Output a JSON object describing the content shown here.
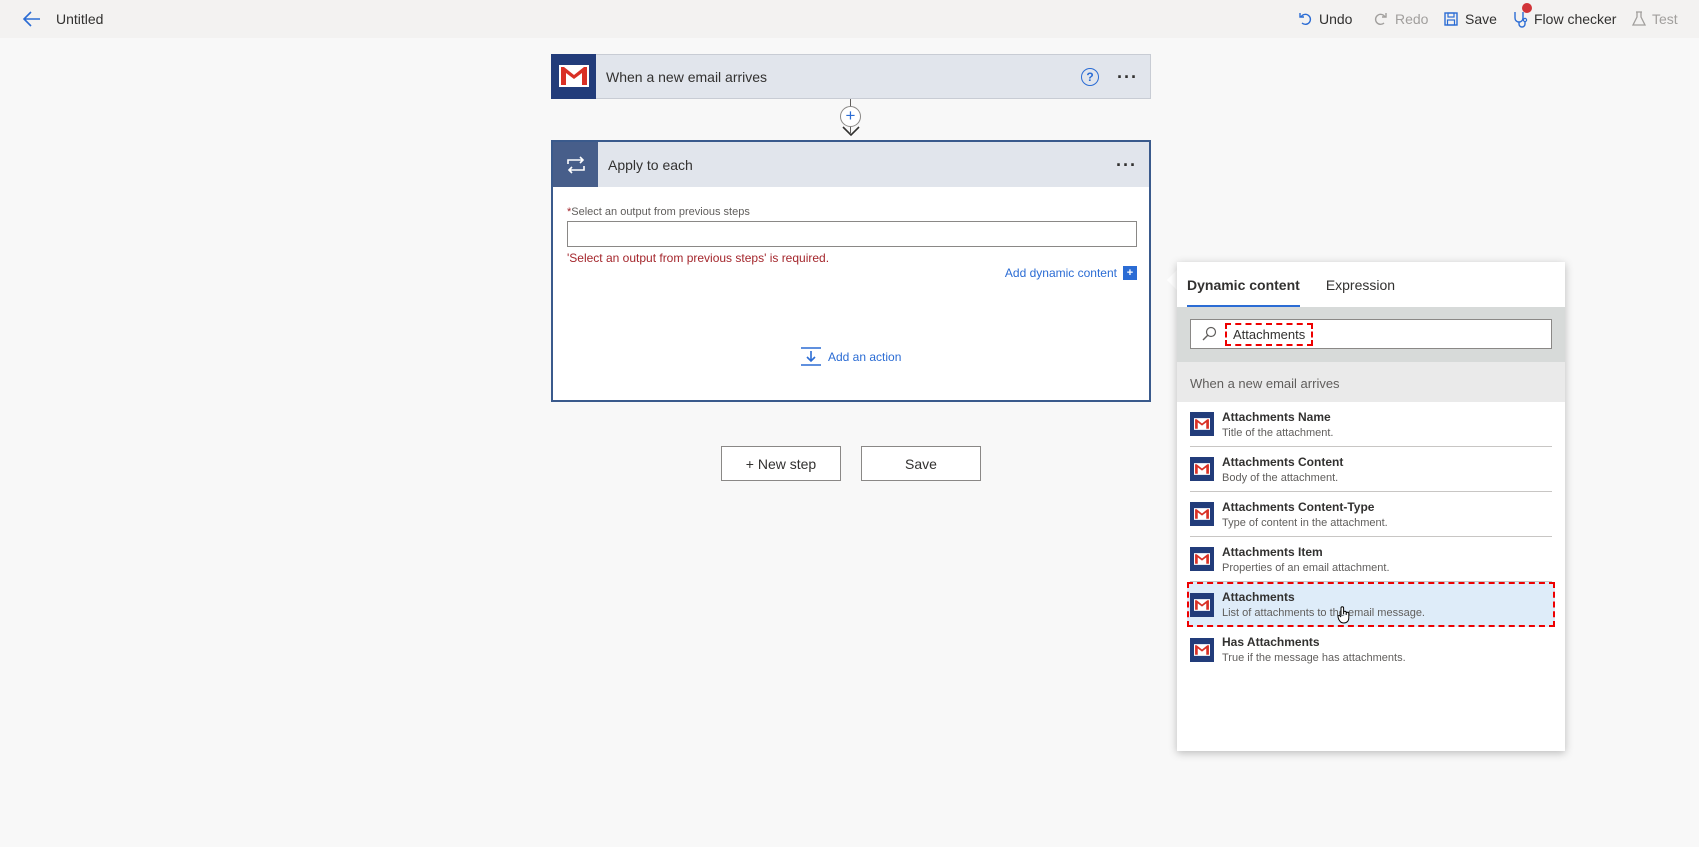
{
  "topbar": {
    "title": "Untitled",
    "undo": "Undo",
    "redo": "Redo",
    "save": "Save",
    "flow_checker": "Flow checker",
    "test": "Test"
  },
  "trigger": {
    "title": "When a new email arrives"
  },
  "apply": {
    "title": "Apply to each",
    "field_label": "Select an output from previous steps",
    "required_mark": "*",
    "error": "'Select an output from previous steps' is required.",
    "dynamic_link": "Add dynamic content",
    "add_action": "Add an action"
  },
  "buttons": {
    "new_step": "+ New step",
    "save": "Save"
  },
  "panel": {
    "tabs": [
      "Dynamic content",
      "Expression"
    ],
    "search_value": "Attachments",
    "group": "When a new email arrives",
    "items": [
      {
        "name": "Attachments Name",
        "desc": "Title of the attachment."
      },
      {
        "name": "Attachments Content",
        "desc": "Body of the attachment."
      },
      {
        "name": "Attachments Content-Type",
        "desc": "Type of content in the attachment."
      },
      {
        "name": "Attachments Item",
        "desc": "Properties of an email attachment."
      },
      {
        "name": "Attachments",
        "desc": "List of attachments to the email message."
      },
      {
        "name": "Has Attachments",
        "desc": "True if the message has attachments."
      }
    ]
  },
  "colors": {
    "accent": "#2b6cd4",
    "error": "#a4262c",
    "gmail_tile": "#223c7a",
    "highlight": "#e00000"
  }
}
